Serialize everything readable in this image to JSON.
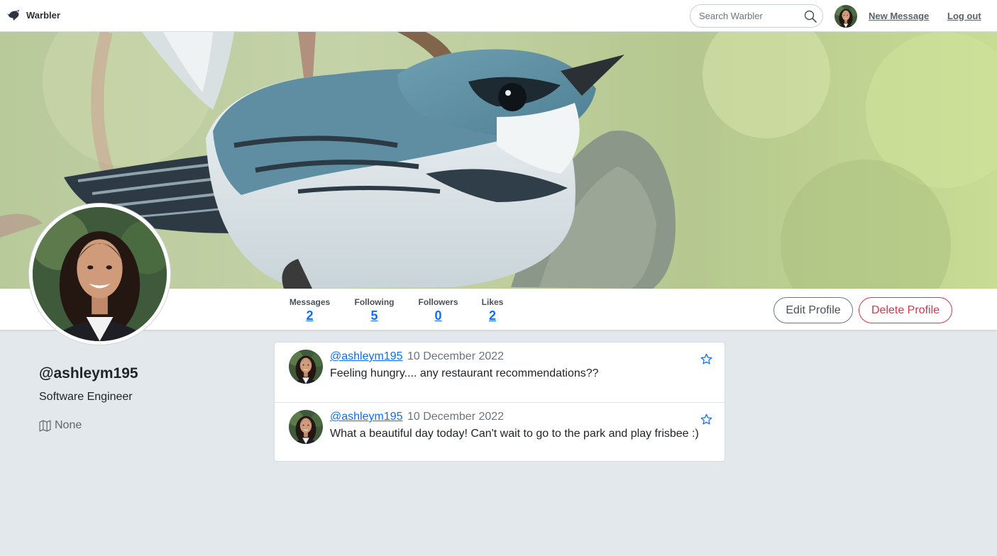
{
  "navbar": {
    "brand": "Warbler",
    "search_placeholder": "Search Warbler",
    "new_message": "New Message",
    "logout": "Log out"
  },
  "stats": [
    {
      "label": "Messages",
      "value": "2"
    },
    {
      "label": "Following",
      "value": "5"
    },
    {
      "label": "Followers",
      "value": "0"
    },
    {
      "label": "Likes",
      "value": "2"
    }
  ],
  "actions": {
    "edit": "Edit Profile",
    "delete": "Delete Profile"
  },
  "profile": {
    "username": "@ashleym195",
    "bio": "Software Engineer",
    "location": "None"
  },
  "messages": [
    {
      "user": "@ashleym195",
      "date": "10 December 2022",
      "text": "Feeling hungry.... any restaurant recommendations??"
    },
    {
      "user": "@ashleym195",
      "date": "10 December 2022",
      "text": "What a beautiful day today! Can't wait to go to the park and play frisbee :)"
    }
  ],
  "colors": {
    "accent": "#0d6efd",
    "danger": "#dc3545",
    "page_bg": "#e2e8ec"
  }
}
